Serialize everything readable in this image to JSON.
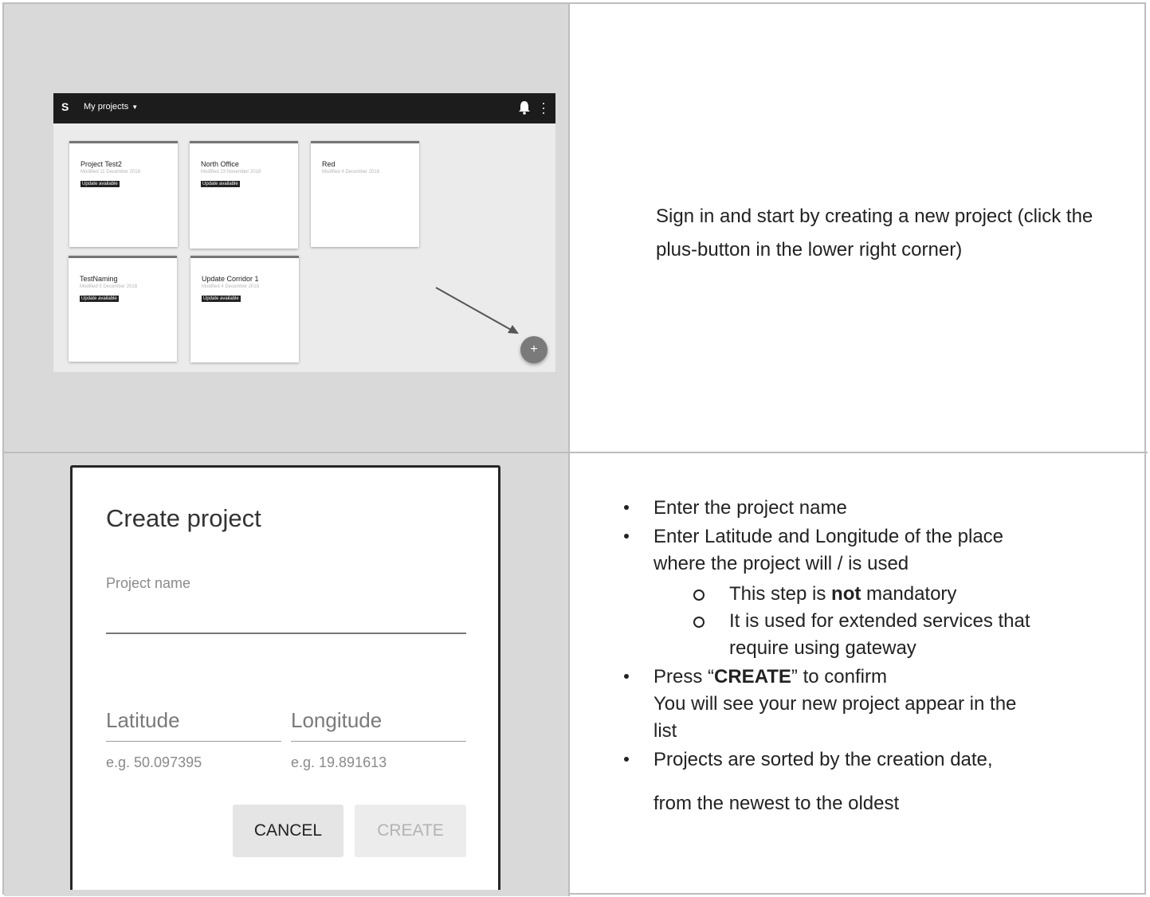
{
  "screenshot1": {
    "app_logo": "S",
    "nav_title": "My projects",
    "cards": [
      {
        "title": "Project Test2",
        "date": "Modified 11 December 2018",
        "badge": "Update available"
      },
      {
        "title": "North Office",
        "date": "Modified 23 November 2018",
        "badge": "Update available"
      },
      {
        "title": "Red",
        "date": "Modified 4 December 2018",
        "badge": ""
      },
      {
        "title": "TestNaming",
        "date": "Modified 5 December 2018",
        "badge": "Update available"
      },
      {
        "title": "Update Corridor 1",
        "date": "Modified 4 December 2018",
        "badge": "Update available"
      }
    ],
    "fab_symbol": "+"
  },
  "description1": "Sign in and start by creating a new project (click the plus-button in the lower right corner)",
  "dialog": {
    "title": "Create project",
    "project_name_label": "Project name",
    "latitude_label": "Latitude",
    "longitude_label": "Longitude",
    "latitude_hint": "e.g. 50.097395",
    "longitude_hint": "e.g. 19.891613",
    "cancel_label": "CANCEL",
    "create_label": "CREATE"
  },
  "instructions": {
    "b1": "Enter the project name",
    "b2_line1": "Enter Latitude and Longitude of the place",
    "b2_line2": "where the project will / is used",
    "sub1_pre": "This step is ",
    "sub1_bold": "not",
    "sub1_post": " mandatory",
    "sub2_line1": "It is used for extended services that",
    "sub2_line2": "require using gateway",
    "b3_pre": "Press “",
    "b3_bold": "CREATE",
    "b3_post": "” to confirm",
    "b3_line2": "You will see your new project appear in the",
    "b3_line3": "list",
    "b4_line1": "Projects are sorted by the creation date,",
    "b4_line2": "from the newest to the oldest"
  }
}
